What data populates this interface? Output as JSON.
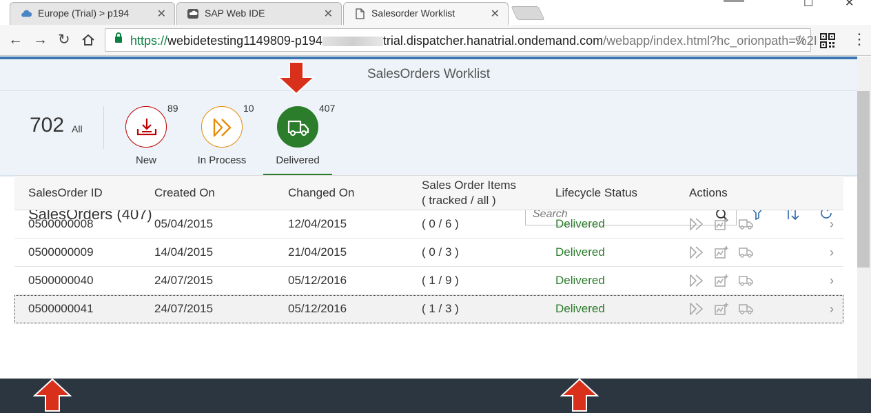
{
  "browser": {
    "tabs": [
      {
        "label": "Europe (Trial) > p194",
        "icon": "cloud-icon"
      },
      {
        "label": "SAP Web IDE",
        "icon": "sap-webide-icon"
      },
      {
        "label": "Salesorder Worklist",
        "icon": "page-icon"
      }
    ],
    "url_scheme": "https://",
    "url_host_a": "webidetesting1149809-p194",
    "url_host_b": "trial.dispatcher.hanatrial.ondemand.com",
    "url_path": "/webapp/index.html?hc_orionpath=%2I"
  },
  "app": {
    "title": "SalesOrders Worklist",
    "total_count": "702",
    "total_label": "All",
    "icon_tabs": [
      {
        "label": "New",
        "count": "89",
        "color": "#bb0000"
      },
      {
        "label": "In Process",
        "count": "10",
        "color": "#e78c07"
      },
      {
        "label": "Delivered",
        "count": "407",
        "color": "#2b7c2b"
      }
    ],
    "table_title": "SalesOrders (407)",
    "search_placeholder": "Search",
    "columns": [
      "SalesOrder ID",
      "Created On",
      "Changed On",
      "Sales Order Items",
      "( tracked / all )",
      "Lifecycle Status",
      "Actions"
    ],
    "rows": [
      {
        "id": "0500000008",
        "created": "05/04/2015",
        "changed": "12/04/2015",
        "items": "( 0 / 6 )",
        "status": "Delivered"
      },
      {
        "id": "0500000009",
        "created": "14/04/2015",
        "changed": "21/04/2015",
        "items": "( 0 / 3 )",
        "status": "Delivered"
      },
      {
        "id": "0500000040",
        "created": "24/07/2015",
        "changed": "05/12/2016",
        "items": "( 1 / 9 )",
        "status": "Delivered"
      },
      {
        "id": "0500000041",
        "created": "24/07/2015",
        "changed": "05/12/2016",
        "items": "( 1 / 3 )",
        "status": "Delivered"
      }
    ]
  },
  "colors": {
    "accent_blue": "#3b76b0",
    "delivered_green": "#2b7c2b",
    "annotation_arrow": "#d9301c",
    "footer": "#2b3640"
  }
}
